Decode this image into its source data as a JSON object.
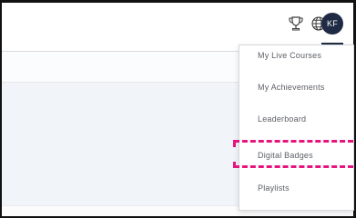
{
  "header": {
    "trophy_icon": "trophy-icon",
    "globe_icon": "globe-icon",
    "avatar_initials": "KF"
  },
  "dropdown": {
    "items": [
      {
        "label": "My Live Courses"
      },
      {
        "label": "My Achievements"
      },
      {
        "label": "Leaderboard"
      },
      {
        "label": "Digital Badges"
      },
      {
        "label": "Playlists"
      }
    ]
  },
  "colors": {
    "highlight": "#e6147d",
    "avatar_bg": "#1f2a44"
  }
}
